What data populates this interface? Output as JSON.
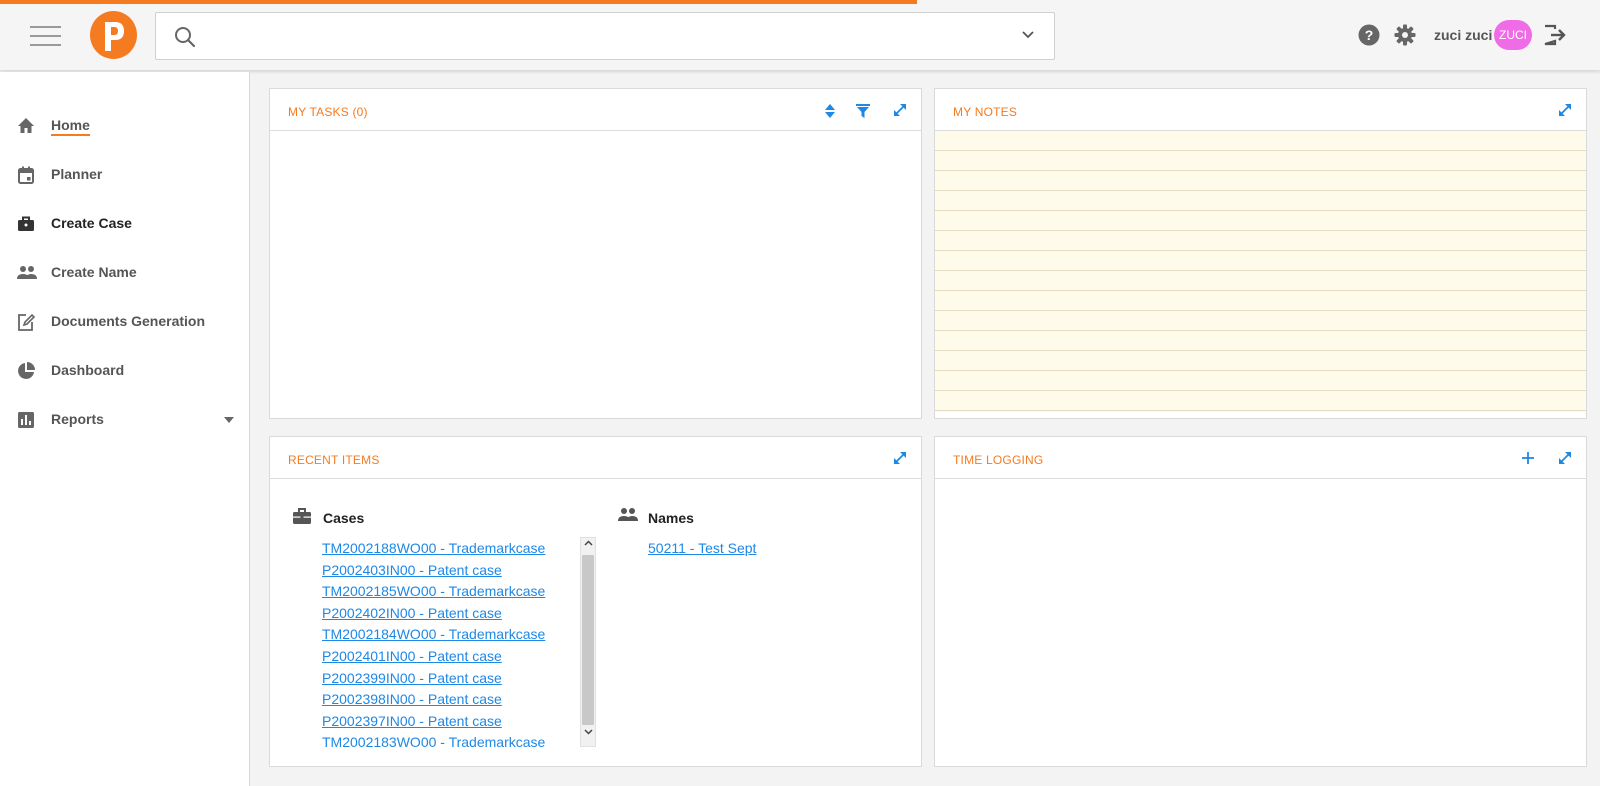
{
  "header": {
    "search_placeholder": "",
    "username": "zuci zuci",
    "avatar_initials": "ZUCI"
  },
  "sidebar": {
    "items": [
      {
        "label": "Home",
        "icon": "home-icon"
      },
      {
        "label": "Planner",
        "icon": "calendar-icon"
      },
      {
        "label": "Create Case",
        "icon": "briefcase-icon"
      },
      {
        "label": "Create Name",
        "icon": "people-icon"
      },
      {
        "label": "Documents Generation",
        "icon": "edit-document-icon"
      },
      {
        "label": "Dashboard",
        "icon": "pie-chart-icon"
      },
      {
        "label": "Reports",
        "icon": "bar-chart-icon"
      }
    ]
  },
  "panels": {
    "my_tasks": {
      "title": "MY TASKS (0)"
    },
    "my_notes": {
      "title": "MY NOTES"
    },
    "recent_items": {
      "title": "RECENT ITEMS",
      "cases_title": "Cases",
      "names_title": "Names",
      "cases": [
        "TM2002188WO00 - Trademarkcase",
        "P2002403IN00 - Patent case",
        "TM2002185WO00 - Trademarkcase",
        "P2002402IN00 - Patent case",
        "TM2002184WO00 - Trademarkcase",
        "P2002401IN00 - Patent case",
        "P2002399IN00 - Patent case",
        "P2002398IN00 - Patent case",
        "P2002397IN00 - Patent case",
        "TM2002183WO00 - Trademarkcase"
      ],
      "names": [
        "50211 - Test Sept"
      ]
    },
    "time_logging": {
      "title": "TIME LOGGING"
    }
  },
  "colors": {
    "accent": "#f47b20",
    "link": "#1e88e5",
    "avatar": "#f06ce6",
    "notes_background": "#fffbea"
  }
}
